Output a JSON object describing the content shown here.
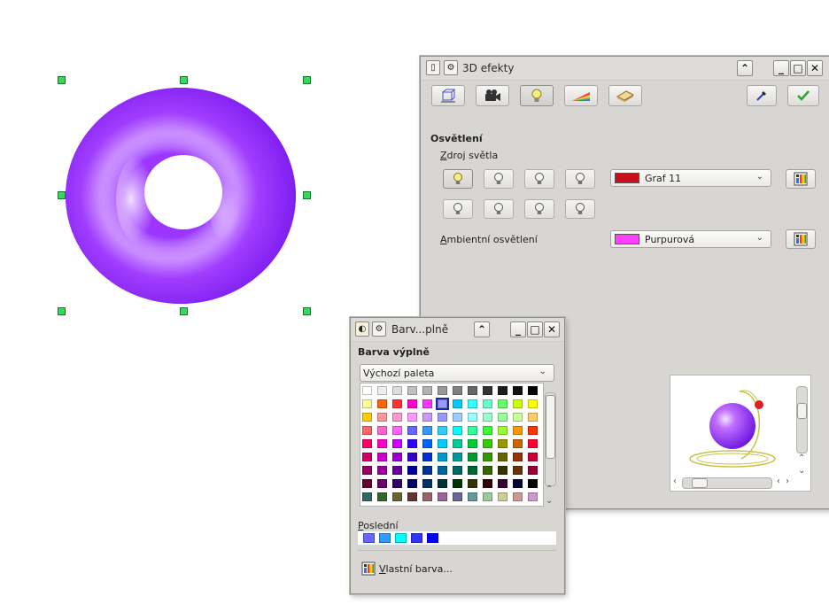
{
  "canvas": {
    "object_color": "#9b35ff"
  },
  "effects_window": {
    "title": "3D efekty",
    "toolbar_icons": [
      "geometry-icon",
      "shading-icon",
      "lighting-icon",
      "textures-icon",
      "material-icon"
    ],
    "section_title": "Osvětlení",
    "light_source_label_u": "Z",
    "light_source_label_rest": "droj světla",
    "light_color": {
      "name": "Graf 11",
      "hex": "#c8101a"
    },
    "ambient_label_u": "A",
    "ambient_label_rest": "mbientní osvětlení",
    "ambient_color": {
      "name": "Purpurová",
      "hex": "#ff3fff"
    }
  },
  "fill_window": {
    "title": "Barv...plně",
    "section_title": "Barva výplně",
    "palette_select": "Výchozí paleta",
    "recent_label_u": "P",
    "recent_label_rest": "oslední",
    "custom_color_u": "V",
    "custom_color_rest": "lastní barva...",
    "palette_rows": [
      [
        "#ffffff",
        "#eeeeee",
        "#dddddd",
        "#c0c0c0",
        "#b2b2b2",
        "#999999",
        "#808080",
        "#666666",
        "#333333",
        "#1c1c1c",
        "#111111",
        "#000000"
      ],
      [
        "#ffff99",
        "#ff6600",
        "#ff3333",
        "#ff00cc",
        "#ff33ff",
        "#9999ff",
        "#00ccff",
        "#33ffff",
        "#66ffcc",
        "#66ff66",
        "#ccff00",
        "#ffff00"
      ],
      [
        "#ffcc00",
        "#ff9999",
        "#ff99cc",
        "#ff99ff",
        "#cc99ff",
        "#9999ff",
        "#99ccff",
        "#99ffff",
        "#99ffcc",
        "#99ff99",
        "#ccff99",
        "#ffcc66"
      ],
      [
        "#ff6666",
        "#ff66cc",
        "#ff66ff",
        "#6666ff",
        "#3399ff",
        "#33ccff",
        "#00ffff",
        "#33ff99",
        "#33ff33",
        "#99ff33",
        "#ff9900",
        "#ff3300"
      ],
      [
        "#ff0066",
        "#ff00cc",
        "#cc00ff",
        "#3300ff",
        "#0066ff",
        "#00ccff",
        "#00cc99",
        "#00cc33",
        "#33cc00",
        "#999900",
        "#cc6600",
        "#ff0033"
      ],
      [
        "#cc0066",
        "#cc00cc",
        "#9900cc",
        "#3300cc",
        "#0033cc",
        "#0099cc",
        "#009999",
        "#009933",
        "#339900",
        "#666600",
        "#993300",
        "#cc0033"
      ],
      [
        "#990066",
        "#990099",
        "#660099",
        "#000099",
        "#003399",
        "#006699",
        "#006666",
        "#006633",
        "#336600",
        "#333300",
        "#663300",
        "#990033"
      ],
      [
        "#660033",
        "#660066",
        "#330066",
        "#000066",
        "#003366",
        "#003333",
        "#003300",
        "#333300",
        "#330000",
        "#330033",
        "#000033",
        "#000000"
      ],
      [
        "#336666",
        "#336633",
        "#666633",
        "#663333",
        "#996666",
        "#996699",
        "#666699",
        "#669999",
        "#99cc99",
        "#cccc99",
        "#cc9999",
        "#cc99cc"
      ]
    ],
    "selected_cell": "1-5",
    "recent_colors": [
      "#6666ff",
      "#3399ff",
      "#00ffff",
      "#3333ff",
      "#0000ff"
    ]
  }
}
